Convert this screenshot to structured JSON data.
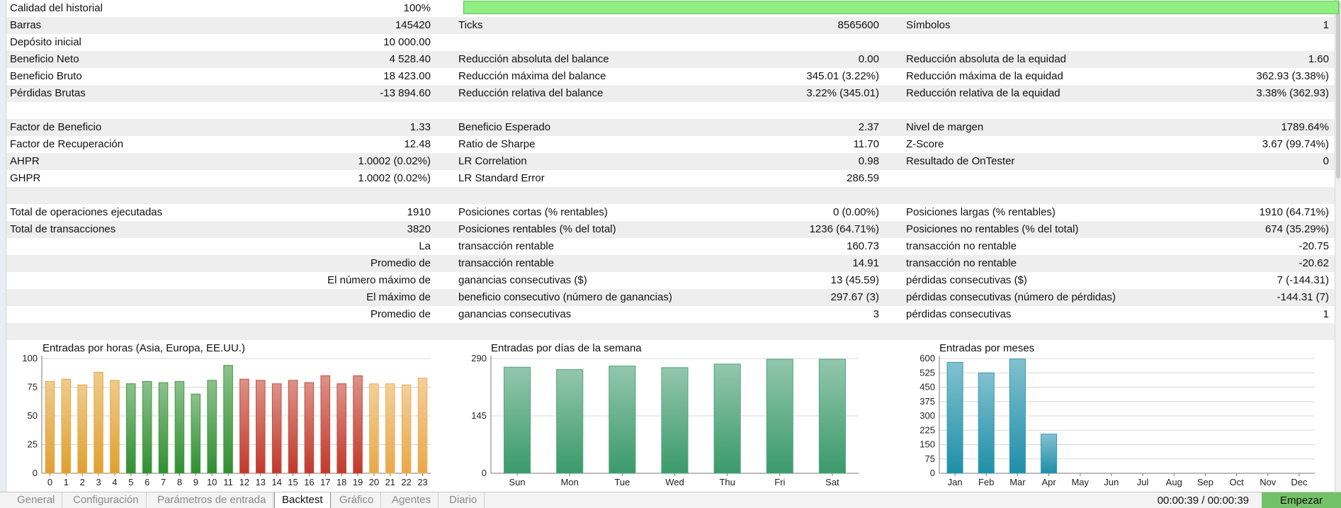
{
  "summary": {
    "history_quality": {
      "label": "Calidad del historial",
      "value": "100%",
      "fraction": 1.0
    },
    "rows": [
      {
        "c1": "Barras",
        "v1": "145420",
        "c2": "Ticks",
        "v2": "8565600",
        "c3": "Símbolos",
        "v3": "1"
      },
      {
        "c1": "Depósito inicial",
        "v1": "10 000.00",
        "c2": "",
        "v2": "",
        "c3": "",
        "v3": ""
      },
      {
        "c1": "Beneficio Neto",
        "v1": "4 528.40",
        "c2": "Reducción absoluta del balance",
        "v2": "0.00",
        "c3": "Reducción absoluta de la equidad",
        "v3": "1.60"
      },
      {
        "c1": "Beneficio Bruto",
        "v1": "18 423.00",
        "c2": "Reducción máxima del balance",
        "v2": "345.01 (3.22%)",
        "c3": "Reducción máxima de la equidad",
        "v3": "362.93 (3.38%)"
      },
      {
        "c1": "Pérdidas Brutas",
        "v1": "-13 894.60",
        "c2": "Reducción relativa del balance",
        "v2": "3.22% (345.01)",
        "c3": "Reducción relativa de la equidad",
        "v3": "3.38% (362.93)"
      },
      {
        "c1": "",
        "v1": "",
        "c2": "",
        "v2": "",
        "c3": "",
        "v3": ""
      },
      {
        "c1": "Factor de Beneficio",
        "v1": "1.33",
        "c2": "Beneficio Esperado",
        "v2": "2.37",
        "c3": "Nivel de margen",
        "v3": "1789.64%"
      },
      {
        "c1": "Factor de Recuperación",
        "v1": "12.48",
        "c2": "Ratio de Sharpe",
        "v2": "11.70",
        "c3": "Z-Score",
        "v3": "3.67 (99.74%)"
      },
      {
        "c1": "AHPR",
        "v1": "1.0002 (0.02%)",
        "c2": "LR Correlation",
        "v2": "0.98",
        "c3": "Resultado de OnTester",
        "v3": "0"
      },
      {
        "c1": "GHPR",
        "v1": "1.0002 (0.02%)",
        "c2": "LR Standard Error",
        "v2": "286.59",
        "c3": "",
        "v3": ""
      },
      {
        "c1": "",
        "v1": "",
        "c2": "",
        "v2": "",
        "c3": "",
        "v3": ""
      },
      {
        "c1": "Total de operaciones ejecutadas",
        "v1": "1910",
        "c2": "Posiciones cortas (% rentables)",
        "v2": "0 (0.00%)",
        "c3": "Posiciones largas (% rentables)",
        "v3": "1910 (64.71%)"
      },
      {
        "c1": "Total de transacciones",
        "v1": "3820",
        "c2": "Posiciones rentables (% del total)",
        "v2": "1236 (64.71%)",
        "c3": "Posiciones no rentables (% del total)",
        "v3": "674 (35.29%)"
      },
      {
        "c1": "",
        "v1": "La",
        "c2": "transacción rentable",
        "v2": "160.73",
        "c3": "transacción no rentable",
        "v3": "-20.75"
      },
      {
        "c1": "",
        "v1": "Promedio de",
        "c2": "transacción rentable",
        "v2": "14.91",
        "c3": "transacción no rentable",
        "v3": "-20.62"
      },
      {
        "c1": "",
        "v1": "El número máximo de",
        "c2": "ganancias consecutivas ($)",
        "v2": "13 (45.59)",
        "c3": "pérdidas consecutivas ($)",
        "v3": "7 (-144.31)"
      },
      {
        "c1": "",
        "v1": "El máximo de",
        "c2": "beneficio consecutivo (número de ganancias)",
        "v2": "297.67 (3)",
        "c3": "pérdidas consecutivas (número de pérdidas)",
        "v3": "-144.31 (7)"
      },
      {
        "c1": "",
        "v1": "Promedio de",
        "c2": "ganancias consecutivas",
        "v2": "3",
        "c3": "pérdidas consecutivas",
        "v3": "1"
      },
      {
        "c1": "",
        "v1": "",
        "c2": "",
        "v2": "",
        "c3": "",
        "v3": ""
      }
    ]
  },
  "chart_data": [
    {
      "type": "bar",
      "title": "Entradas por horas (Asia, Europa, EE.UU.)",
      "categories": [
        "0",
        "1",
        "2",
        "3",
        "4",
        "5",
        "6",
        "7",
        "8",
        "9",
        "10",
        "11",
        "12",
        "13",
        "14",
        "15",
        "16",
        "17",
        "18",
        "19",
        "20",
        "21",
        "22",
        "23"
      ],
      "values": [
        80,
        82,
        77,
        88,
        81,
        78,
        80,
        79,
        80,
        69,
        81,
        94,
        82,
        81,
        78,
        81,
        79,
        85,
        78,
        85,
        78,
        78,
        77,
        83
      ],
      "yticks": [
        "0",
        "25",
        "50",
        "75",
        "100"
      ],
      "ylim": [
        0,
        100
      ],
      "colors": {
        "asia": "#e0a030",
        "europe": "#2f8f2f",
        "usa": "#c0392b",
        "late": "#e9a84a"
      }
    },
    {
      "type": "bar",
      "title": "Entradas por días de la semana",
      "categories": [
        "Sun",
        "Mon",
        "Tue",
        "Wed",
        "Thu",
        "Fri",
        "Sat"
      ],
      "values": [
        268,
        262,
        271,
        267,
        276,
        288,
        288
      ],
      "yticks": [
        "0",
        "145",
        "290"
      ],
      "ylim": [
        0,
        290
      ],
      "colors": {
        "bar": "#3a9a6a"
      }
    },
    {
      "type": "bar",
      "title": "Entradas por meses",
      "categories": [
        "Jan",
        "Feb",
        "Mar",
        "Apr",
        "May",
        "Jun",
        "Jul",
        "Aug",
        "Sep",
        "Oct",
        "Nov",
        "Dec"
      ],
      "values": [
        580,
        525,
        597,
        205,
        0,
        0,
        0,
        0,
        0,
        0,
        0,
        0
      ],
      "yticks": [
        "0",
        "75",
        "150",
        "225",
        "300",
        "375",
        "450",
        "525",
        "600"
      ],
      "ylim": [
        0,
        600
      ],
      "colors": {
        "bar": "#1e8fa8"
      }
    }
  ],
  "tabs": [
    {
      "label": "General",
      "active": false
    },
    {
      "label": "Configuración",
      "active": false
    },
    {
      "label": "Parámetros de entrada",
      "active": false
    },
    {
      "label": "Backtest",
      "active": true
    },
    {
      "label": "Gráfico",
      "active": false
    },
    {
      "label": "Agentes",
      "active": false
    },
    {
      "label": "Diario",
      "active": false
    }
  ],
  "status": {
    "timer": "00:00:39 / 00:00:39",
    "start_label": "Empezar"
  }
}
